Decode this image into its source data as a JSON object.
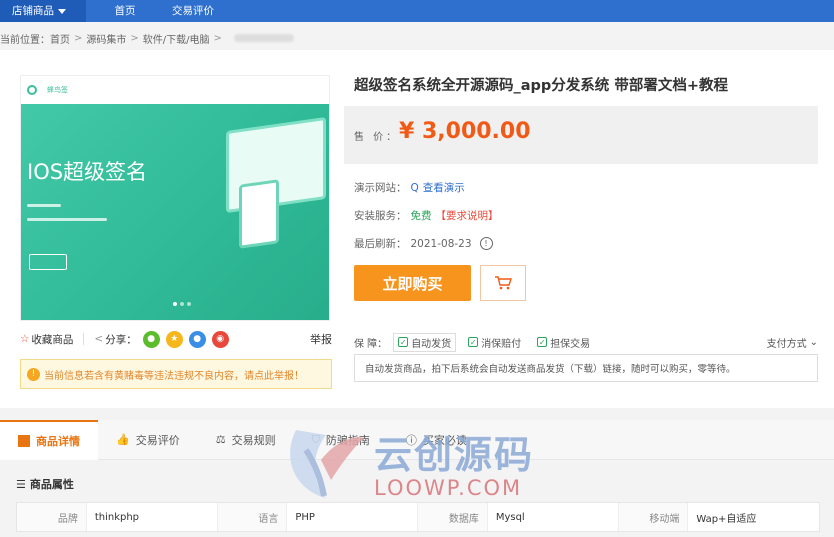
{
  "topnav": {
    "category_label": "店铺商品",
    "home_label": "首页",
    "reviews_label": "交易评价"
  },
  "breadcrumb": {
    "prefix": "当前位置：",
    "items": [
      "首页",
      "源码集市",
      "软件/下载/电脑"
    ]
  },
  "product": {
    "image": {
      "hero_text": "IOS超级签名",
      "logo_text": "蜂鸟签"
    },
    "title": "超级签名系统全开源源码_app分发系统 带部署文档+教程",
    "price_label": "售 价：",
    "price": "¥ 3,000.00",
    "demo_label": "演示网站：",
    "demo_link": "查看演示",
    "install_label": "安装服务：",
    "install_value": "免费",
    "install_note": "【要求说明】",
    "refresh_label": "最后刷新：",
    "refresh_date": "2021-08-23",
    "buy_label": "立即购买"
  },
  "share": {
    "favorite": "收藏商品",
    "share_label": "分享：",
    "report": "举报"
  },
  "warning": "当前信息若含有黄赌毒等违法违规不良内容，请点此举报！",
  "guarantee": {
    "label": "保 障：",
    "tags": [
      "自动发货",
      "消保赔付",
      "担保交易"
    ],
    "pay_label": "支付方式"
  },
  "notice": "自动发货商品，拍下后系统会自动发送商品发货（下载）链接，随时可以购买，零等待。",
  "tabs": [
    {
      "label": "商品详情",
      "active": true
    },
    {
      "label": "交易评价"
    },
    {
      "label": "交易规则"
    },
    {
      "label": "防骗指南"
    },
    {
      "label": "买家必读"
    }
  ],
  "attributes": {
    "heading": "商品属性",
    "rows": [
      {
        "key": "品牌",
        "value": "thinkphp"
      },
      {
        "key": "语言",
        "value": "PHP"
      },
      {
        "key": "数据库",
        "value": "Mysql"
      },
      {
        "key": "移动端",
        "value": "Wap+自适应"
      }
    ]
  },
  "watermark": {
    "cn": "云创源码",
    "en": "LOOWP.COM"
  },
  "colors": {
    "nav_blue": "#2f6fce",
    "price_orange": "#f15a16",
    "buy_orange": "#f7941d",
    "hero_green": "#42c9a8"
  }
}
